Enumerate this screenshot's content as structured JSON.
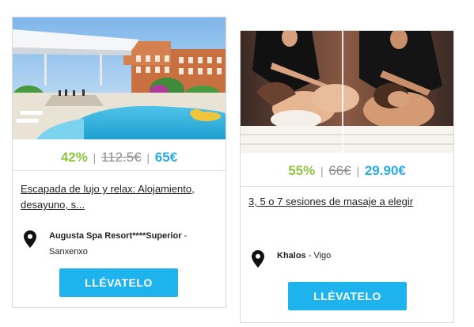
{
  "deals": [
    {
      "discount": "42%",
      "separator": "|",
      "old_price": "112.5€",
      "new_price": "65€",
      "title": "Escapada de lujo y relax: Alojamiento, desayuno, s...",
      "location_name": "Augusta Spa Resort****Superior",
      "location_suffix": " - Sanxenxo",
      "button_label": "LLÉVATELO",
      "image": "resort-pool-photo",
      "pin_icon": "map-pin-icon"
    },
    {
      "discount": "55%",
      "separator": "|",
      "old_price": "66€",
      "new_price": "29.90€",
      "title": "3, 5 o 7 sesiones de masaje a elegir",
      "location_name": "Khalos",
      "location_suffix": " - Vigo",
      "button_label": "LLÉVATELO",
      "image": "couples-massage-photo",
      "pin_icon": "map-pin-icon"
    }
  ],
  "colors": {
    "discount": "#8dc63f",
    "new_price": "#29abe2",
    "button": "#1fb3ee",
    "old_price": "#8c8c8c"
  }
}
